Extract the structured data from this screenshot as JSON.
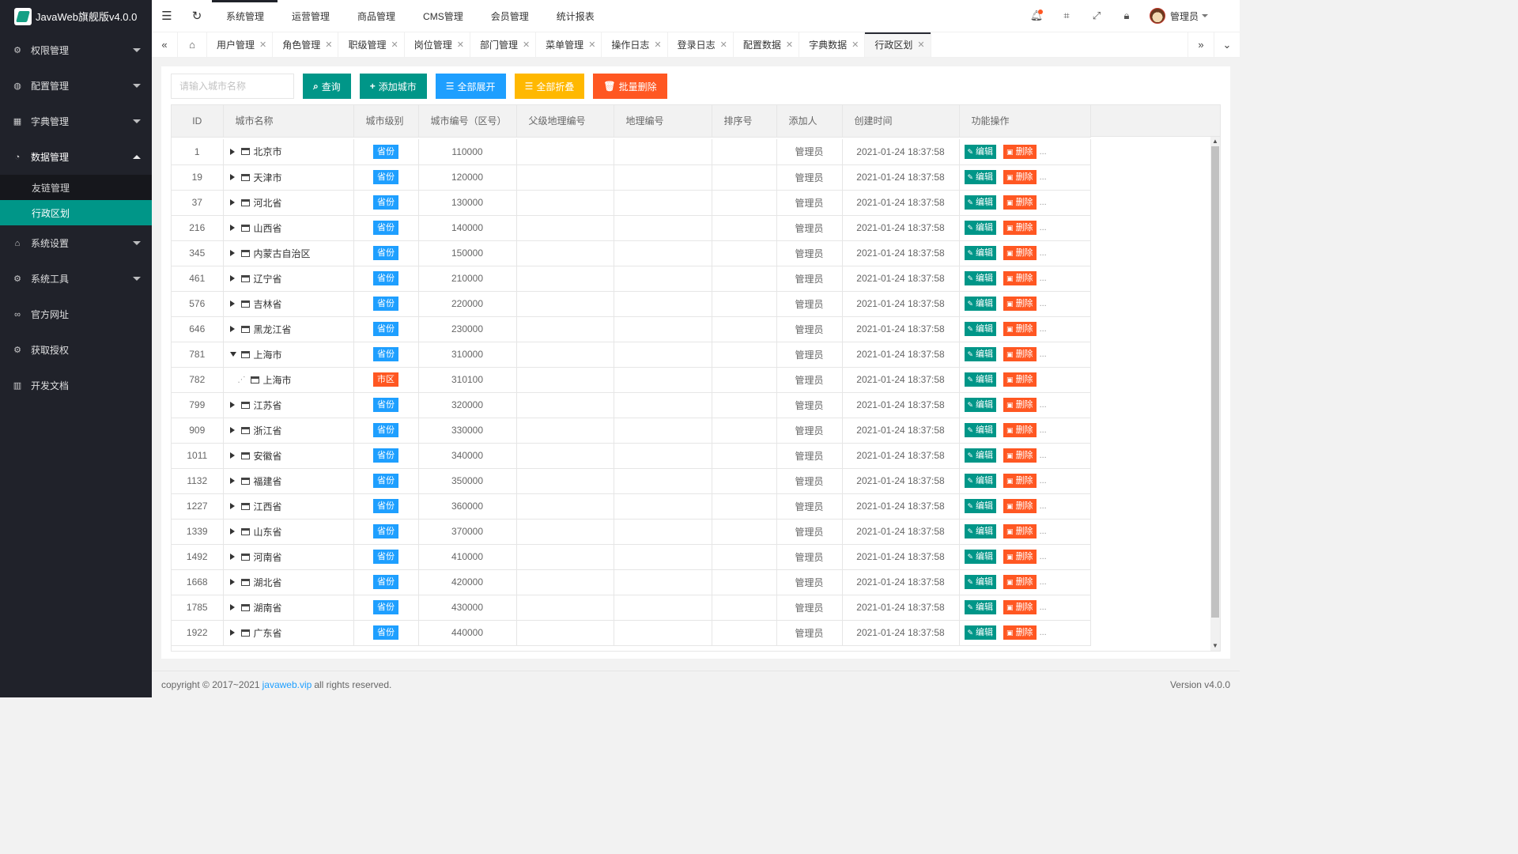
{
  "app": {
    "title": "JavaWeb旗舰版v4.0.0"
  },
  "sidebar": {
    "items": [
      {
        "label": "权限管理",
        "icon": "gear-icon",
        "glyph": "⚙",
        "arrow": "down"
      },
      {
        "label": "配置管理",
        "icon": "globe-icon",
        "glyph": "◍",
        "arrow": "down"
      },
      {
        "label": "字典管理",
        "icon": "grid-icon",
        "glyph": "▦",
        "arrow": "down"
      },
      {
        "label": "数据管理",
        "icon": "dashboard-icon",
        "glyph": "◔",
        "arrow": "up"
      }
    ],
    "sub_items": [
      {
        "label": "友链管理",
        "active": false
      },
      {
        "label": "行政区划",
        "active": true
      }
    ],
    "items_after": [
      {
        "label": "系统设置",
        "icon": "home-icon",
        "glyph": "⌂",
        "arrow": "down"
      },
      {
        "label": "系统工具",
        "icon": "gear-icon",
        "glyph": "⚙",
        "arrow": "down"
      },
      {
        "label": "官方网址",
        "icon": "link-icon",
        "glyph": "∞",
        "arrow": ""
      },
      {
        "label": "获取授权",
        "icon": "gear-icon",
        "glyph": "⚙",
        "arrow": ""
      },
      {
        "label": "开发文档",
        "icon": "book-icon",
        "glyph": "▥",
        "arrow": ""
      }
    ]
  },
  "header": {
    "nav": [
      "系统管理",
      "运营管理",
      "商品管理",
      "CMS管理",
      "会员管理",
      "统计报表"
    ],
    "active_nav": 0,
    "user": "管理员"
  },
  "tabs": {
    "items": [
      "用户管理",
      "角色管理",
      "职级管理",
      "岗位管理",
      "部门管理",
      "菜单管理",
      "操作日志",
      "登录日志",
      "配置数据",
      "字典数据",
      "行政区划"
    ],
    "active": 10
  },
  "toolbar": {
    "search_placeholder": "请输入城市名称",
    "query": "查询",
    "add": "添加城市",
    "expand_all": "全部展开",
    "collapse_all": "全部折叠",
    "batch_delete": "批量删除"
  },
  "table": {
    "columns": [
      "ID",
      "城市名称",
      "城市级别",
      "城市编号（区号）",
      "父级地理编号",
      "地理编号",
      "排序号",
      "添加人",
      "创建时间",
      "功能操作"
    ],
    "edit_label": "编辑",
    "delete_label": "删除",
    "rows": [
      {
        "id": "1",
        "name": "北京市",
        "level": "省份",
        "code": "110000",
        "creator": "管理员",
        "time": "2021-01-24 18:37:58",
        "node": "closed"
      },
      {
        "id": "19",
        "name": "天津市",
        "level": "省份",
        "code": "120000",
        "creator": "管理员",
        "time": "2021-01-24 18:37:58",
        "node": "closed"
      },
      {
        "id": "37",
        "name": "河北省",
        "level": "省份",
        "code": "130000",
        "creator": "管理员",
        "time": "2021-01-24 18:37:58",
        "node": "closed"
      },
      {
        "id": "216",
        "name": "山西省",
        "level": "省份",
        "code": "140000",
        "creator": "管理员",
        "time": "2021-01-24 18:37:58",
        "node": "closed"
      },
      {
        "id": "345",
        "name": "内蒙古自治区",
        "level": "省份",
        "code": "150000",
        "creator": "管理员",
        "time": "2021-01-24 18:37:58",
        "node": "closed"
      },
      {
        "id": "461",
        "name": "辽宁省",
        "level": "省份",
        "code": "210000",
        "creator": "管理员",
        "time": "2021-01-24 18:37:58",
        "node": "closed"
      },
      {
        "id": "576",
        "name": "吉林省",
        "level": "省份",
        "code": "220000",
        "creator": "管理员",
        "time": "2021-01-24 18:37:58",
        "node": "closed"
      },
      {
        "id": "646",
        "name": "黑龙江省",
        "level": "省份",
        "code": "230000",
        "creator": "管理员",
        "time": "2021-01-24 18:37:58",
        "node": "closed"
      },
      {
        "id": "781",
        "name": "上海市",
        "level": "省份",
        "code": "310000",
        "creator": "管理员",
        "time": "2021-01-24 18:37:58",
        "node": "open"
      },
      {
        "id": "782",
        "name": "上海市",
        "level": "市区",
        "code": "310100",
        "creator": "管理员",
        "time": "2021-01-24 18:37:58",
        "node": "leaf"
      },
      {
        "id": "799",
        "name": "江苏省",
        "level": "省份",
        "code": "320000",
        "creator": "管理员",
        "time": "2021-01-24 18:37:58",
        "node": "closed"
      },
      {
        "id": "909",
        "name": "浙江省",
        "level": "省份",
        "code": "330000",
        "creator": "管理员",
        "time": "2021-01-24 18:37:58",
        "node": "closed"
      },
      {
        "id": "1011",
        "name": "安徽省",
        "level": "省份",
        "code": "340000",
        "creator": "管理员",
        "time": "2021-01-24 18:37:58",
        "node": "closed"
      },
      {
        "id": "1132",
        "name": "福建省",
        "level": "省份",
        "code": "350000",
        "creator": "管理员",
        "time": "2021-01-24 18:37:58",
        "node": "closed"
      },
      {
        "id": "1227",
        "name": "江西省",
        "level": "省份",
        "code": "360000",
        "creator": "管理员",
        "time": "2021-01-24 18:37:58",
        "node": "closed"
      },
      {
        "id": "1339",
        "name": "山东省",
        "level": "省份",
        "code": "370000",
        "creator": "管理员",
        "time": "2021-01-24 18:37:58",
        "node": "closed"
      },
      {
        "id": "1492",
        "name": "河南省",
        "level": "省份",
        "code": "410000",
        "creator": "管理员",
        "time": "2021-01-24 18:37:58",
        "node": "closed"
      },
      {
        "id": "1668",
        "name": "湖北省",
        "level": "省份",
        "code": "420000",
        "creator": "管理员",
        "time": "2021-01-24 18:37:58",
        "node": "closed"
      },
      {
        "id": "1785",
        "name": "湖南省",
        "level": "省份",
        "code": "430000",
        "creator": "管理员",
        "time": "2021-01-24 18:37:58",
        "node": "closed"
      },
      {
        "id": "1922",
        "name": "广东省",
        "level": "省份",
        "code": "440000",
        "creator": "管理员",
        "time": "2021-01-24 18:37:58",
        "node": "closed"
      }
    ]
  },
  "footer": {
    "copyright_prefix": "copyright © 2017~2021",
    "link": "javaweb.vip",
    "copyright_suffix": "all rights reserved.",
    "version": "Version v4.0.0"
  },
  "colors": {
    "accent": "#009688",
    "blue": "#1e9fff",
    "orange": "#ffb800",
    "red": "#ff5722",
    "sidebar": "#20222a"
  }
}
